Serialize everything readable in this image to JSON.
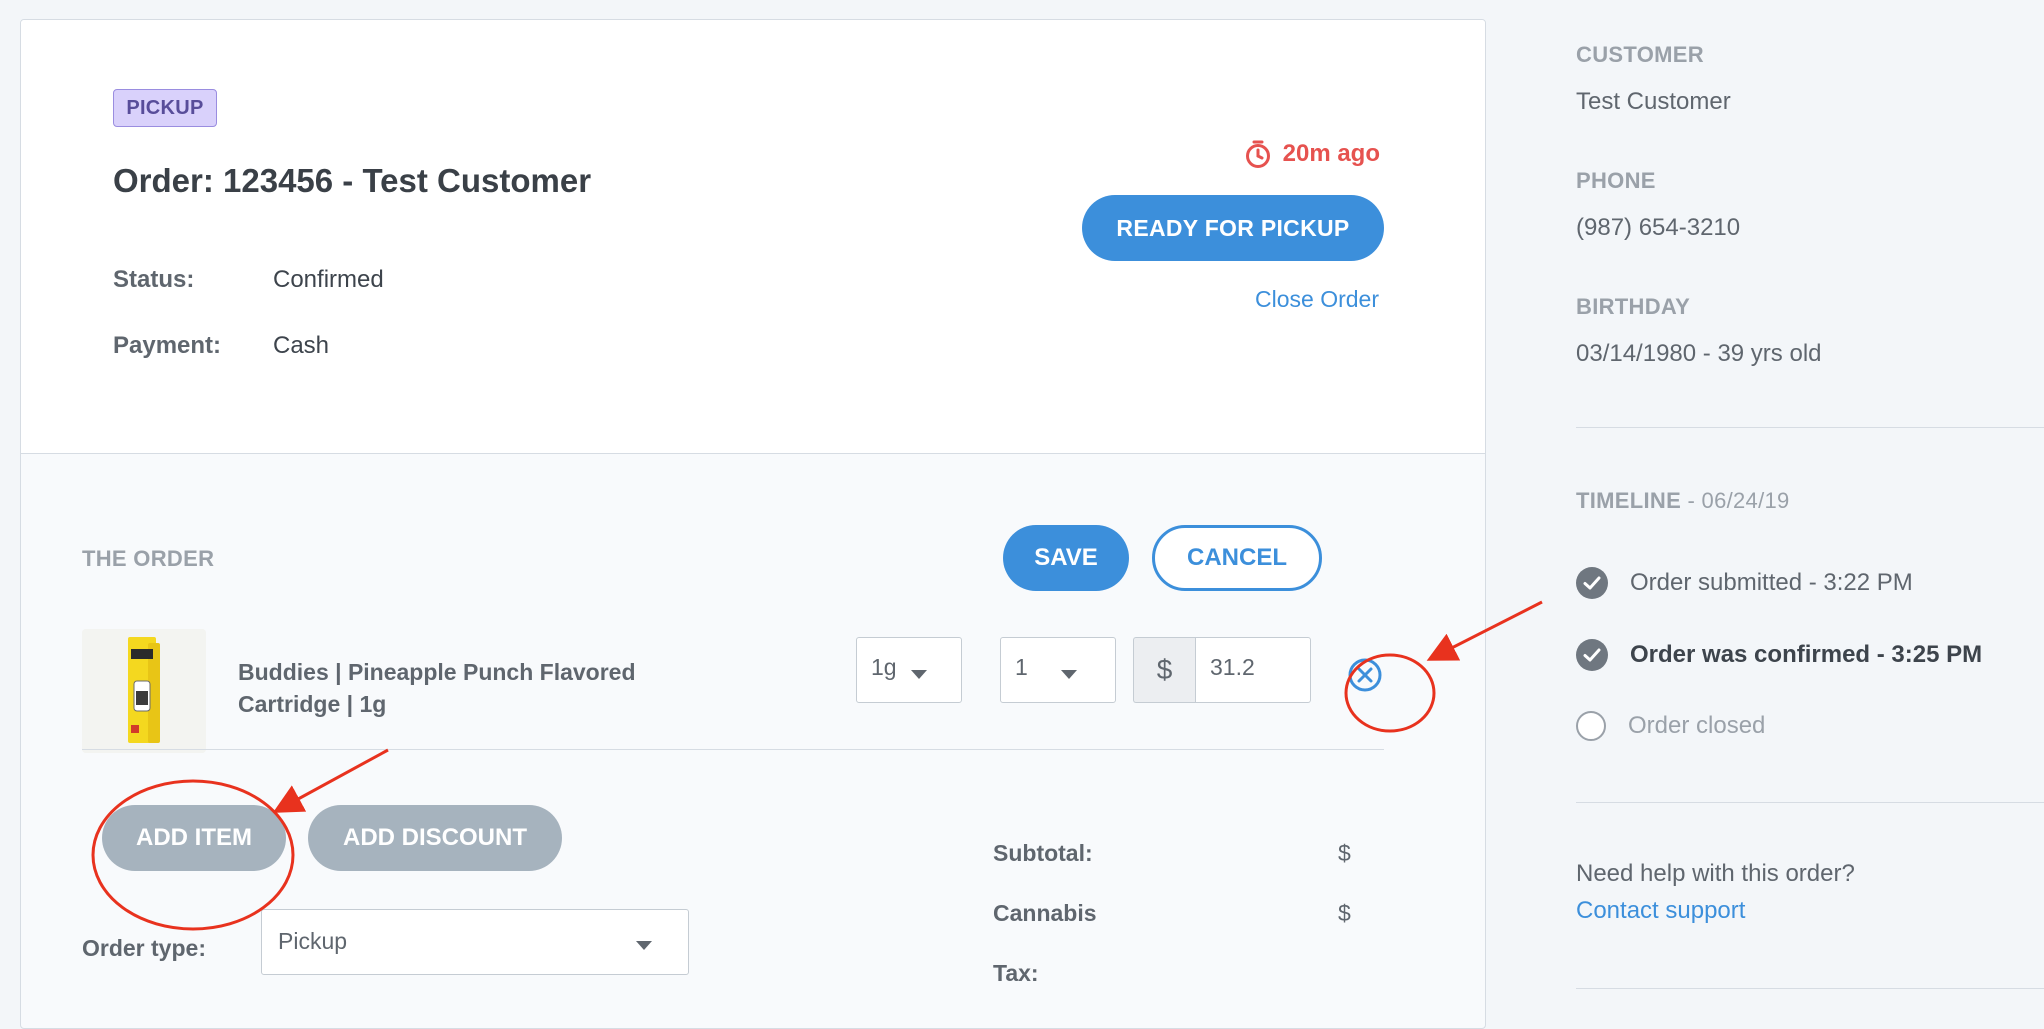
{
  "order": {
    "badge": "PICKUP",
    "title": "Order: 123456 - Test Customer",
    "status_label": "Status:",
    "status_value": "Confirmed",
    "payment_label": "Payment:",
    "payment_value": "Cash",
    "elapsed": "20m ago",
    "ready_button": "READY FOR PICKUP",
    "close_link": "Close Order"
  },
  "items_section": {
    "title": "THE ORDER",
    "save_button": "SAVE",
    "cancel_button": "CANCEL",
    "items": [
      {
        "name": "Buddies | Pineapple Punch Flavored Cartridge | 1g",
        "size": "1g",
        "quantity": "1",
        "currency": "$",
        "price": "31.2"
      }
    ],
    "add_item_button": "ADD ITEM",
    "add_discount_button": "ADD DISCOUNT",
    "order_type_label": "Order type:",
    "order_type_value": "Pickup",
    "summary": [
      {
        "label": "Subtotal:",
        "value": "$"
      },
      {
        "label": "Cannabis",
        "value": "$"
      },
      {
        "label": "Tax:",
        "value": ""
      }
    ]
  },
  "sidebar": {
    "customer_heading": "CUSTOMER",
    "customer_name": "Test Customer",
    "phone_heading": "PHONE",
    "phone": "(987) 654-3210",
    "birthday_heading": "BIRTHDAY",
    "birthday": "03/14/1980 - 39 yrs old",
    "timeline_heading": "TIMELINE",
    "timeline_date": " - 06/24/19",
    "timeline": [
      {
        "text": "Order submitted - 3:22 PM",
        "done": true
      },
      {
        "text": "Order was confirmed - 3:25 PM",
        "done": true
      },
      {
        "text": "Order closed",
        "done": false
      }
    ],
    "help_text": "Need help with this order?",
    "support_link": "Contact support"
  },
  "colors": {
    "accent": "#3c8fdb",
    "alert": "#e6524f",
    "badge_bg": "#d9d1fb",
    "annotation": "#e8321e"
  },
  "icons": [
    "stopwatch-icon",
    "chevron-down-icon",
    "remove-item-icon",
    "check-circle-icon"
  ]
}
